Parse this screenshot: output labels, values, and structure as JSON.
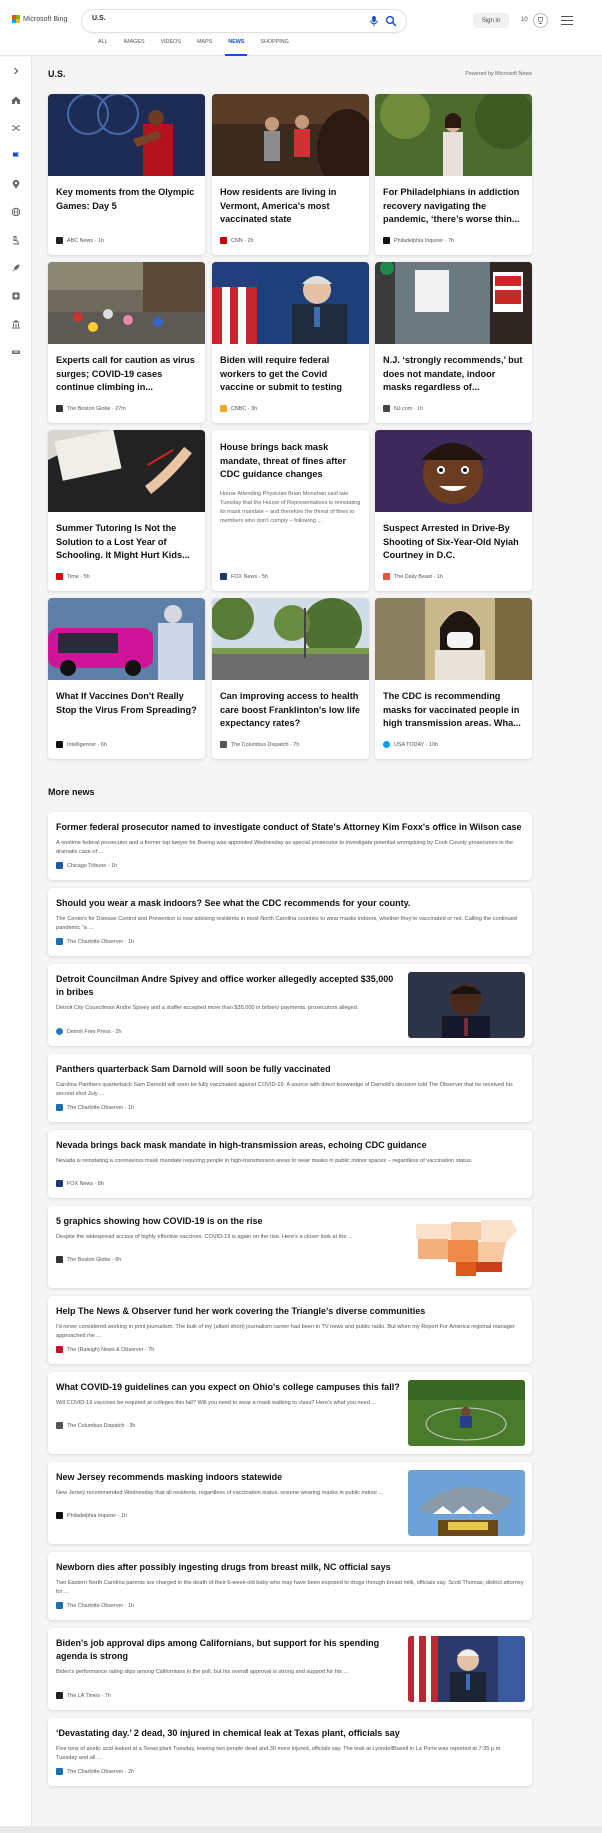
{
  "header": {
    "logo_text": "Microsoft Bing",
    "search_value": "U.S.",
    "signin_label": "Sign in",
    "rewards_count": "10"
  },
  "nav": {
    "tabs": [
      {
        "label": "ALL"
      },
      {
        "label": "IMAGES"
      },
      {
        "label": "VIDEOS"
      },
      {
        "label": "MAPS"
      },
      {
        "label": "NEWS"
      },
      {
        "label": "SHOPPING"
      }
    ],
    "active": "NEWS"
  },
  "sidebar": {
    "icons": [
      "expand-arrow-icon",
      "home-icon",
      "shuffle-icon",
      "flag-icon",
      "location-icon",
      "globe-icon",
      "microscope-icon",
      "rocket-icon",
      "film-icon",
      "building-icon",
      "car-icon"
    ]
  },
  "section": {
    "title": "U.S.",
    "powered_by": "Powered by Microsoft News"
  },
  "cards": [
    {
      "title": "Key moments from the Olympic Games: Day 5",
      "source": "ABC News",
      "time": "1h",
      "logo_color": "#222222"
    },
    {
      "title": "How residents are living in Vermont, America's most vaccinated state",
      "source": "CNN",
      "time": "2h",
      "logo_color": "#cc0000"
    },
    {
      "title": "For Philadelphians in addiction recovery navigating the pandemic, ‘there’s worse thin...",
      "source": "Philadelphia Inquirer",
      "time": "7h",
      "logo_color": "#111111"
    },
    {
      "title": "Experts call for caution as virus surges; COVID-19 cases continue climbing in...",
      "source": "The Boston Globe",
      "time": "27m",
      "logo_color": "#333333"
    },
    {
      "title": "Biden will require federal workers to get the Covid vaccine or submit to testing",
      "source": "CNBC",
      "time": "3h",
      "logo_color": "#f5a623"
    },
    {
      "title": "N.J. ‘strongly recommends,’ but does not mandate, indoor masks regardless of...",
      "source": "NJ.com",
      "time": "1h",
      "logo_color": "#444444"
    },
    {
      "title": "Summer Tutoring Is Not the Solution to a Lost Year of Schooling. It Might Hurt Kids...",
      "source": "Time",
      "time": "5h",
      "logo_color": "#e4000f"
    },
    {
      "title": "House brings back mask mandate, threat of fines after CDC guidance changes",
      "snippet": "House Attending Physician Brian Monahan said late Tuesday that the House of Representatives is reinstating its mask mandate – and therefore the threat of fines to members who don't comply – following ...",
      "source": "FOX News",
      "time": "5h",
      "logo_color": "#1b3a6b"
    },
    {
      "title": "Suspect Arrested in Drive-By Shooting of Six-Year-Old Nyiah Courtney in D.C.",
      "source": "The Daily Beast",
      "time": "1h",
      "logo_color": "#e8543b"
    },
    {
      "title": "What If Vaccines Don't Really Stop the Virus From Spreading?",
      "source": "Intelligencer",
      "time": "6h",
      "logo_color": "#111111"
    },
    {
      "title": "Can improving access to health care boost Franklinton's low life expectancy rates?",
      "source": "The Columbus Dispatch",
      "time": "7h",
      "logo_color": "#555555"
    },
    {
      "title": "The CDC is recommending masks for vaccinated people in high transmission areas. Wha...",
      "source": "USA TODAY",
      "time": "10h",
      "logo_color": "#009bff"
    }
  ],
  "more_news": {
    "title": "More news",
    "items": [
      {
        "title": "Former federal prosecutor named to investigate conduct of State's Attorney Kim Foxx's office in Wilson case",
        "snippet": "A onetime federal prosecutor and a former top lawyer for Boeing was appointed Wednesday as special prosecutor to investigate potential wrongdoing by Cook County prosecutors in the dramatic case of ...",
        "source": "Chicago Tribune",
        "time": "1h",
        "logo_color": "#1a5aa8"
      },
      {
        "title": "Should you wear a mask indoors? See what the CDC recommends for your county.",
        "snippet": "The Centers for Disease Control and Prevention is now advising residents in most North Carolina counties to wear masks indoors, whether they're vaccinated or not. Calling the continued pandemic \"a ...",
        "source": "The Charlotte Observer",
        "time": "1h",
        "logo_color": "#1a6fb3"
      },
      {
        "title": "Detroit Councilman Andre Spivey and office worker allegedly accepted $35,000 in bribes",
        "snippet": "Detroit City Councilman Andre Spivey and a staffer accepted more than $35,000 in bribery payments, prosecutors alleged.",
        "source": "Detroit Free Press",
        "time": "2h",
        "logo_color": "#2a7bbf"
      },
      {
        "title": "Panthers quarterback Sam Darnold will soon be fully vaccinated",
        "snippet": "Carolina Panthers quarterback Sam Darnold will soon be fully vaccinated against COVID-19. A source with direct knowledge of Darnold's decision told The Observer that he received his second shot July ...",
        "source": "The Charlotte Observer",
        "time": "1h",
        "logo_color": "#1a6fb3"
      },
      {
        "title": "Nevada brings back mask mandate in high-transmission areas, echoing CDC guidance",
        "snippet": "Nevada is reinstating a coronavirus mask mandate requiring people in high-transmission areas to wear masks in public indoor spaces – regardless of vaccination status.",
        "source": "FOX News",
        "time": "8h",
        "logo_color": "#1b3a6b"
      },
      {
        "title": "5 graphics showing how COVID-19 is on the rise",
        "snippet": "Despite the widespread access of highly effective vaccines, COVID-19 is again on the rise. Here's a closer look at the ...",
        "source": "The Boston Globe",
        "time": "6h",
        "logo_color": "#333333"
      },
      {
        "title": "Help The News & Observer fund her work covering the Triangle's diverse communities",
        "snippet": "I'd never considered working in print journalism. The bulk of my (albeit short) journalism career had been in TV news and public radio. But when my Report For America regional manager approached me ...",
        "source": "The (Raleigh) News & Observer",
        "time": "7h",
        "logo_color": "#c8102e"
      },
      {
        "title": "What COVID-19 guidelines can you expect on Ohio's college campuses this fall?",
        "snippet": "Will COVID-19 vaccines be required at colleges this fall? Will you need to wear a mask walking to class? Here's what you need ...",
        "source": "The Columbus Dispatch",
        "time": "3h",
        "logo_color": "#555555"
      },
      {
        "title": "New Jersey recommends masking indoors statewide",
        "snippet": "New Jersey recommended Wednesday that all residents, regardless of vaccination status, resume wearing masks in public indoor ...",
        "source": "Philadelphia Inquirer",
        "time": "1h",
        "logo_color": "#111111"
      },
      {
        "title": "Newborn dies after possibly ingesting drugs from breast milk, NC official says",
        "snippet": "Two Eastern North Carolina parents are charged in the death of their 6-week-old baby who may have been exposed to drugs through breast milk, officials say. Scott Thomas, district attorney for ...",
        "source": "The Charlotte Observer",
        "time": "1h",
        "logo_color": "#1a6fb3"
      },
      {
        "title": "Biden's job approval dips among Californians, but support for his spending agenda is strong",
        "snippet": "Biden's performance rating slips among Californians in the poll, but his overall approval is strong and support for his ...",
        "source": "The LA Times",
        "time": "7h",
        "logo_color": "#222222"
      },
      {
        "title": "‘Devastating day.’ 2 dead, 30 injured in chemical leak at Texas plant, officials say",
        "snippet": "Five tons of acetic acid leaked at a Texas plant Tuesday, leaving two people dead and 30 more injured, officials say. The leak at LyondellBasell in La Porte was reported at 7:35 p.m. Tuesday and all ...",
        "source": "The Charlotte Observer",
        "time": "2h",
        "logo_color": "#1a6fb3"
      }
    ]
  }
}
